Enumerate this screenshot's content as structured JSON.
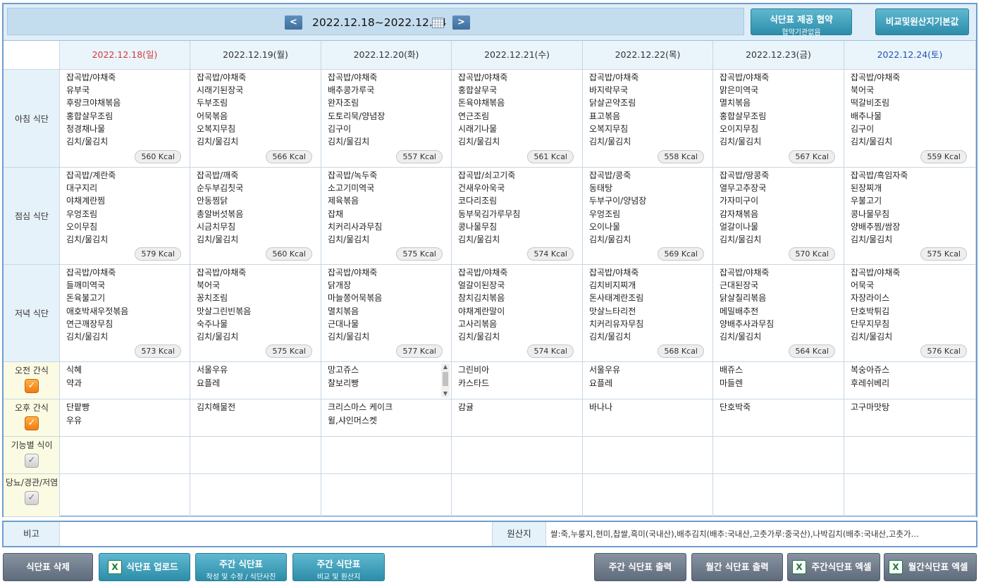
{
  "header": {
    "week_range": "2022.12.18~2022.12.24",
    "prev_label": "<",
    "next_label": ">",
    "agreement_btn": {
      "line1": "식단표 제공 협약",
      "line2": "협약기관없음"
    },
    "compare_btn": "비교및원산지기본값"
  },
  "days": [
    {
      "date": "2022.12.18(일)",
      "kind": "sun"
    },
    {
      "date": "2022.12.19(월)",
      "kind": "weekday"
    },
    {
      "date": "2022.12.20(화)",
      "kind": "weekday"
    },
    {
      "date": "2022.12.21(수)",
      "kind": "weekday"
    },
    {
      "date": "2022.12.22(목)",
      "kind": "weekday"
    },
    {
      "date": "2022.12.23(금)",
      "kind": "weekday"
    },
    {
      "date": "2022.12.24(토)",
      "kind": "sat"
    }
  ],
  "meals": [
    {
      "label": "아침 식단",
      "cells": [
        {
          "items": [
            "잡곡밥/야채죽",
            "유부국",
            "후랑크야채볶음",
            "홍합살무조림",
            "청경채나물",
            "김치/물김치"
          ],
          "kcal": "560 Kcal"
        },
        {
          "items": [
            "잡곡밥/야채죽",
            "시래기된장국",
            "두부조림",
            "어묵볶음",
            "오복지무침",
            "김치/물김치"
          ],
          "kcal": "566 Kcal"
        },
        {
          "items": [
            "잡곡밥/야채죽",
            "배추콩가루국",
            "완자조림",
            "도토리묵/양념장",
            "김구이",
            "김치/물김치"
          ],
          "kcal": "557 Kcal"
        },
        {
          "items": [
            "잡곡밥/야채죽",
            "홍합살무국",
            "돈육야채볶음",
            "연근조림",
            "시래기나물",
            "김치/물김치"
          ],
          "kcal": "561 Kcal"
        },
        {
          "items": [
            "잡곡밥/야채죽",
            "바지락무국",
            "닭살곤약조림",
            "표고볶음",
            "오복지무침",
            "김치/물김치"
          ],
          "kcal": "558 Kcal"
        },
        {
          "items": [
            "잡곡밥/야채죽",
            "맑은미역국",
            "멸치볶음",
            "홍합살무조림",
            "오이지무침",
            "김치/물김치"
          ],
          "kcal": "567 Kcal"
        },
        {
          "items": [
            "잡곡밥/야채죽",
            "북어국",
            "떡갈비조림",
            "배추나물",
            "김구이",
            "김치/물김치"
          ],
          "kcal": "559 Kcal"
        }
      ]
    },
    {
      "label": "점심 식단",
      "cells": [
        {
          "items": [
            "잡곡밥/계란죽",
            "대구지리",
            "야채계란찜",
            "우엉조림",
            "오이무침",
            "김치/물김치"
          ],
          "kcal": "579 Kcal"
        },
        {
          "items": [
            "잡곡밥/깨죽",
            "순두부김칫국",
            "안동찜닭",
            "총알버섯볶음",
            "시금치무침",
            "김치/물김치"
          ],
          "kcal": "560 Kcal"
        },
        {
          "items": [
            "잡곡밥/녹두죽",
            "소고기미역국",
            "제육볶음",
            "잡채",
            "치커리사과무침",
            "김치/물김치"
          ],
          "kcal": "575 Kcal"
        },
        {
          "items": [
            "잡곡밥/쇠고기죽",
            "건새우아욱국",
            "코다리조림",
            "동부묵김가루무침",
            "콩나물무침",
            "김치/물김치"
          ],
          "kcal": "574 Kcal"
        },
        {
          "items": [
            "잡곡밥/콩죽",
            "동태탕",
            "두부구이/양념장",
            "우엉조림",
            "오이나물",
            "김치/물김치"
          ],
          "kcal": "569 Kcal"
        },
        {
          "items": [
            "잡곡밥/땅콩죽",
            "열무고추장국",
            "가자미구이",
            "감자채볶음",
            "얼갈이나물",
            "김치/물김치"
          ],
          "kcal": "570 Kcal"
        },
        {
          "items": [
            "잡곡밥/흑임자죽",
            "된장찌개",
            "우불고기",
            "콩나물무침",
            "양배추찜/쌈장",
            "김치/물김치"
          ],
          "kcal": "575 Kcal"
        }
      ]
    },
    {
      "label": "저녁 식단",
      "cells": [
        {
          "items": [
            "잡곡밥/야채죽",
            "들깨미역국",
            "돈육불고기",
            "애호박새우젓볶음",
            "연근깨장무침",
            "김치/물김치"
          ],
          "kcal": "573 Kcal"
        },
        {
          "items": [
            "잡곡밥/야채죽",
            "북어국",
            "꽁치조림",
            "맛살그린빈볶음",
            "숙주나물",
            "김치/물김치"
          ],
          "kcal": "575 Kcal"
        },
        {
          "items": [
            "잡곡밥/야채죽",
            "닭개장",
            "마늘쫑어묵볶음",
            "멸치볶음",
            "근대나물",
            "김치/물김치"
          ],
          "kcal": "577 Kcal"
        },
        {
          "items": [
            "잡곡밥/야채죽",
            "얼갈이된장국",
            "참치김치볶음",
            "야채계란말이",
            "고사리볶음",
            "김치/물김치"
          ],
          "kcal": "574 Kcal"
        },
        {
          "items": [
            "잡곡밥/야채죽",
            "김치비지찌개",
            "돈사태계란조림",
            "맛살느타리전",
            "치커리유자무침",
            "김치/물김치"
          ],
          "kcal": "568 Kcal"
        },
        {
          "items": [
            "잡곡밥/야채죽",
            "근대된장국",
            "닭살칠리볶음",
            "메밀배추전",
            "양배추사과무침",
            "김치/물김치"
          ],
          "kcal": "564 Kcal"
        },
        {
          "items": [
            "잡곡밥/야채죽",
            "어묵국",
            "자장라이스",
            "단호박튀김",
            "단무지무침",
            "김치/물김치"
          ],
          "kcal": "576 Kcal"
        }
      ]
    }
  ],
  "snacks": [
    {
      "label": "오전 간식",
      "checked": true,
      "cells": [
        [
          "식혜",
          "약과"
        ],
        [
          "서울우유",
          "요플레"
        ],
        [
          "망고쥬스",
          "찰보리빵"
        ],
        [
          "그린비아",
          "카스타드"
        ],
        [
          "서울우유",
          "요플레"
        ],
        [
          "배쥬스",
          "마들렌"
        ],
        [
          "복숭아쥬스",
          "후레쉬베리"
        ]
      ]
    },
    {
      "label": "오후 간식",
      "checked": true,
      "cells": [
        [
          "단팥빵",
          "우유"
        ],
        [
          "김치해물전"
        ],
        [
          "크리스마스 케이크",
          "윌,샤인머스켓"
        ],
        [
          "감귤"
        ],
        [
          "바나나"
        ],
        [
          "단호박죽"
        ],
        [
          "고구마맛탕"
        ]
      ]
    },
    {
      "label": "기능별 식이",
      "checked": false,
      "cells": [
        [],
        [],
        [],
        [],
        [],
        [],
        []
      ]
    },
    {
      "label": "당뇨/경관/저염",
      "checked": false,
      "cells": [
        [],
        [],
        [],
        [],
        [],
        [],
        []
      ]
    }
  ],
  "remarks": {
    "label": "비고",
    "value": "",
    "origin_label": "원산지",
    "origin_text": "쌀:죽,누룽지,현미,찹쌀,흑미(국내산),배추김치(배추:국내산,고춧가루:중국산),나박김치(배추:국내산,고춧가…"
  },
  "bottom_buttons": {
    "delete": "식단표 삭제",
    "upload": "식단표 업로드",
    "weekly_edit": {
      "line1": "주간 식단표",
      "line2": "작성 및 수정 / 식단사진"
    },
    "weekly_compare": {
      "line1": "주간 식단표",
      "line2": "비교 및 원산지"
    },
    "weekly_print": "주간 식단표 출력",
    "monthly_print": "월간 식단표 출력",
    "weekly_excel": "주간식단표 엑셀",
    "monthly_excel": "월간식단표 엑셀",
    "excel_icon_glyph": "X"
  },
  "icons": {
    "check_glyph": "✓",
    "scroll_up": "▲",
    "scroll_down": "▼"
  }
}
